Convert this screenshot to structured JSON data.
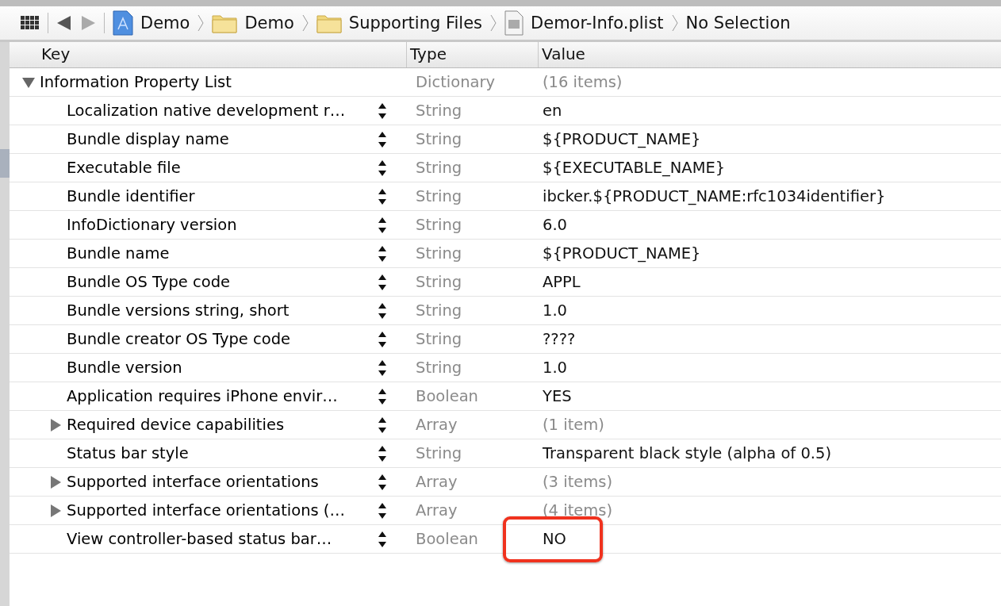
{
  "breadcrumbs": [
    {
      "kind": "project",
      "label": "Demo"
    },
    {
      "kind": "folder",
      "label": "Demo"
    },
    {
      "kind": "folder",
      "label": "Supporting Files"
    },
    {
      "kind": "file",
      "label": "Demor-Info.plist"
    },
    {
      "kind": "plain",
      "label": "No Selection"
    }
  ],
  "table": {
    "columns": [
      "Key",
      "Type",
      "Value"
    ],
    "rows": [
      {
        "key": "Information Property List",
        "type": "Dictionary",
        "value": "(16 items)",
        "kind": "collection",
        "expanded": true,
        "highlighted": false,
        "children": [
          {
            "key": "Localization native development r…",
            "type": "String",
            "value": "en",
            "kind": "scalar",
            "highlighted": false
          },
          {
            "key": "Bundle display name",
            "type": "String",
            "value": "${PRODUCT_NAME}",
            "kind": "scalar",
            "highlighted": false
          },
          {
            "key": "Executable file",
            "type": "String",
            "value": "${EXECUTABLE_NAME}",
            "kind": "scalar",
            "highlighted": false
          },
          {
            "key": "Bundle identifier",
            "type": "String",
            "value": "ibcker.${PRODUCT_NAME:rfc1034identifier}",
            "kind": "scalar",
            "highlighted": false
          },
          {
            "key": "InfoDictionary version",
            "type": "String",
            "value": "6.0",
            "kind": "scalar",
            "highlighted": false
          },
          {
            "key": "Bundle name",
            "type": "String",
            "value": "${PRODUCT_NAME}",
            "kind": "scalar",
            "highlighted": false
          },
          {
            "key": "Bundle OS Type code",
            "type": "String",
            "value": "APPL",
            "kind": "scalar",
            "highlighted": false
          },
          {
            "key": "Bundle versions string, short",
            "type": "String",
            "value": "1.0",
            "kind": "scalar",
            "highlighted": false
          },
          {
            "key": "Bundle creator OS Type code",
            "type": "String",
            "value": "????",
            "kind": "scalar",
            "highlighted": false
          },
          {
            "key": "Bundle version",
            "type": "String",
            "value": "1.0",
            "kind": "scalar",
            "highlighted": false
          },
          {
            "key": "Application requires iPhone envir…",
            "type": "Boolean",
            "value": "YES",
            "kind": "scalar",
            "highlighted": false
          },
          {
            "key": "Required device capabilities",
            "type": "Array",
            "value": "(1 item)",
            "kind": "collection",
            "expanded": false,
            "highlighted": false
          },
          {
            "key": "Status bar style",
            "type": "String",
            "value": "Transparent black style (alpha of 0.5)",
            "kind": "scalar",
            "highlighted": false
          },
          {
            "key": "Supported interface orientations",
            "type": "Array",
            "value": "(3 items)",
            "kind": "collection",
            "expanded": false,
            "highlighted": false
          },
          {
            "key": "Supported interface orientations (…",
            "type": "Array",
            "value": "(4 items)",
            "kind": "collection",
            "expanded": false,
            "highlighted": false
          },
          {
            "key": "View controller-based status bar…",
            "type": "Boolean",
            "value": "NO",
            "kind": "scalar",
            "highlighted": true
          }
        ]
      }
    ]
  }
}
